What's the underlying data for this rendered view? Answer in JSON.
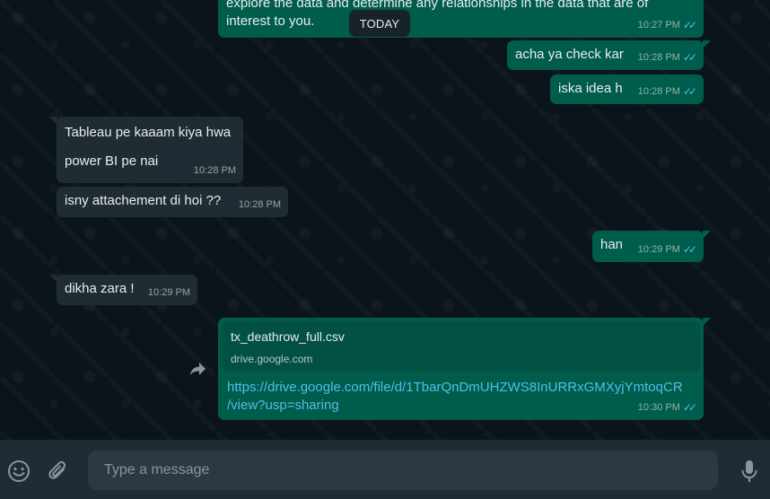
{
  "date_divider": "TODAY",
  "messages": [
    {
      "id": "m1",
      "direction": "out",
      "text_line1": "explore the data and determine any relationships in the data that are of",
      "text_line2": "interest to you.",
      "time": "10:27 PM"
    },
    {
      "id": "m2",
      "direction": "out",
      "text": "acha ya check kar",
      "time": "10:28 PM"
    },
    {
      "id": "m3",
      "direction": "out",
      "text": "iska idea h",
      "time": "10:28 PM"
    },
    {
      "id": "m4",
      "direction": "in",
      "text_line1": "Tableau pe kaaam kiya hwa",
      "text_line2": "power BI pe nai",
      "time": "10:28 PM"
    },
    {
      "id": "m5",
      "direction": "in",
      "text": "isny attachement di hoi ??",
      "time": "10:28 PM"
    },
    {
      "id": "m6",
      "direction": "out",
      "text": "han",
      "time": "10:29 PM"
    },
    {
      "id": "m7",
      "direction": "in",
      "text": "dikha zara !",
      "time": "10:29 PM"
    },
    {
      "id": "m8",
      "direction": "out",
      "link_title": "tx_deathrow_full.csv",
      "link_domain": "drive.google.com",
      "url_line1": "https://drive.google.com/file/d/1TbarQnDmUHZWS8InURRxGMXyjYmtoqCR",
      "url_line2": "/view?usp=sharing",
      "time": "10:30 PM"
    }
  ],
  "composer": {
    "placeholder": "Type a message"
  },
  "colors": {
    "background": "#0b141a",
    "outgoing_bubble": "#005c4b",
    "incoming_bubble": "#202c33",
    "footer": "#202c33",
    "input": "#2a3942",
    "read_ticks": "#53bdeb",
    "link": "#53bdeb"
  },
  "icons": {
    "emoji": "emoji-icon",
    "attach": "paperclip-icon",
    "mic": "microphone-icon",
    "forward": "forward-icon",
    "read_receipt": "double-check-icon"
  }
}
